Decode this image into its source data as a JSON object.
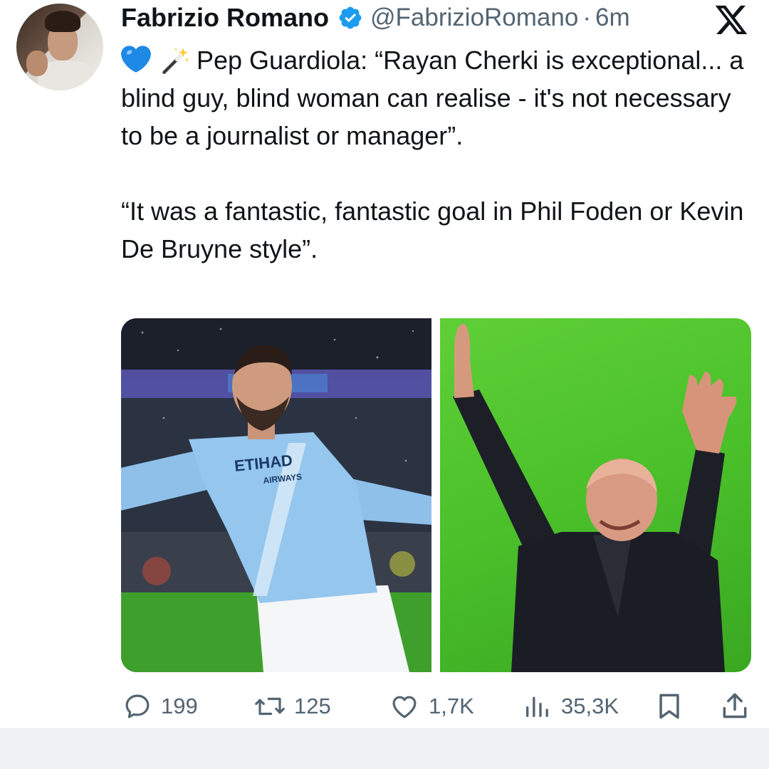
{
  "tweet": {
    "author": {
      "name": "Fabrizio Romano",
      "handle": "@FabrizioRomano",
      "separator": "·",
      "time": "6m"
    },
    "text": {
      "line1": "Pep Guardiola: “Rayan Cherki is exceptional... a blind guy, blind woman can realise - it's not necessary to be a journalist or manager”.",
      "line2": "“It was a fantastic, fantastic goal in Phil Foden or Kevin De Bruyne style”."
    },
    "emojis": [
      "blue-heart",
      "magic-wand"
    ],
    "media": {
      "left_shirt_sponsor_line1": "ETIHAD",
      "left_shirt_sponsor_line2": "AIRWAYS"
    },
    "actions": {
      "replies": "199",
      "reposts": "125",
      "likes": "1,7K",
      "views": "35,3K"
    }
  },
  "icons": [
    "verified-badge-icon",
    "x-logo-icon",
    "reply-icon",
    "repost-icon",
    "like-icon",
    "views-icon",
    "bookmark-icon",
    "share-icon"
  ],
  "colors": {
    "text": "#0f1419",
    "secondary": "#536471",
    "verified": "#1d9bf0",
    "background": "#ffffff"
  }
}
